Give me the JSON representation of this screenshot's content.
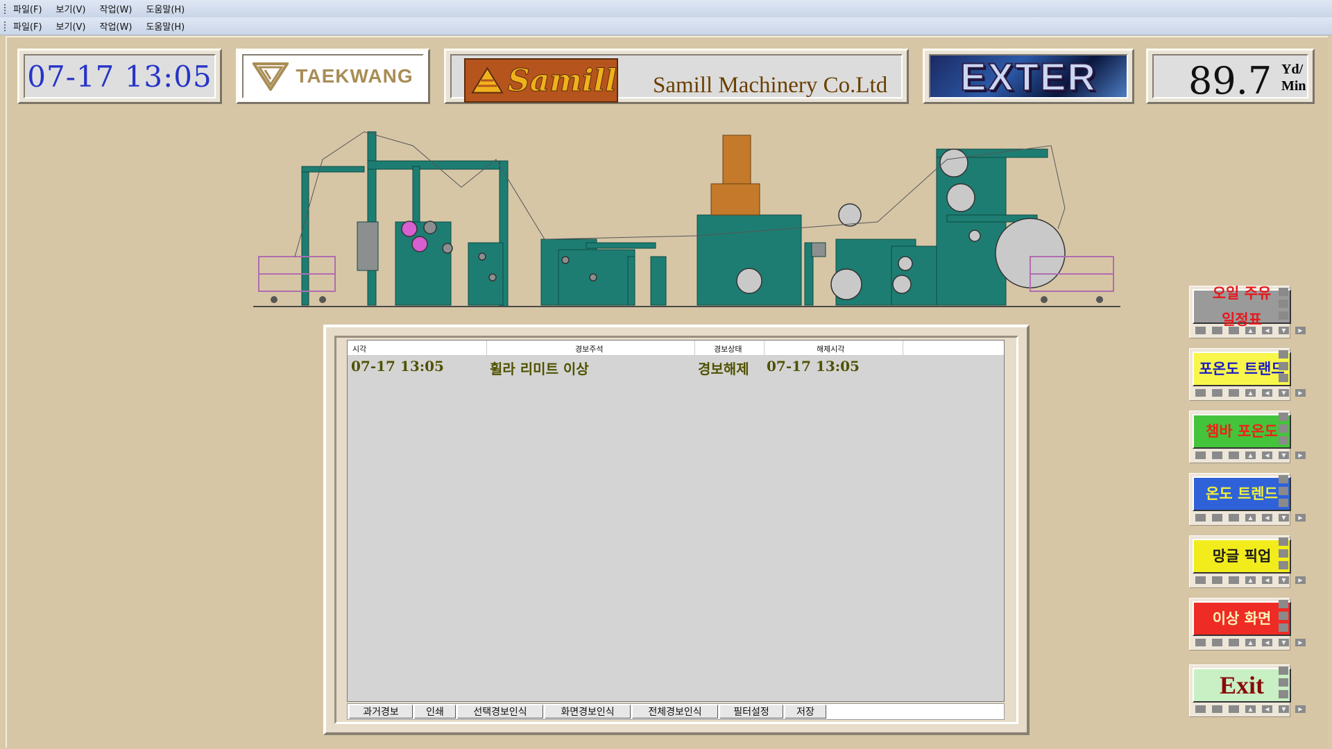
{
  "menus": {
    "top": [
      "파일(F)",
      "보기(V)",
      "작업(W)",
      "도움말(H)"
    ],
    "second": [
      "파일(F)",
      "보기(V)",
      "작업(W)",
      "도움말(H)"
    ]
  },
  "header": {
    "clock": "07-17  13:05",
    "taekwang_logo": "TAEKWANG",
    "samill_logo": "Samill",
    "samill_company": "Samill Machinery Co.Ltd",
    "exter_logo": "EXTER",
    "speed_value": "89.7",
    "speed_unit_top": "Yd/",
    "speed_unit_bottom": "Min"
  },
  "alarm": {
    "columns": [
      "시각",
      "경보주석",
      "경보상태",
      "해제시각"
    ],
    "rows": [
      {
        "time": "07-17 13:05",
        "comment": "휠라 리미트 이상",
        "status": "경보해제",
        "cleared": "07-17 13:05"
      }
    ],
    "toolbar": [
      "과거경보",
      "인쇄",
      "선택경보인식",
      "화면경보인식",
      "전체경보인식",
      "필터설정",
      "저장"
    ]
  },
  "side_buttons": [
    {
      "label_line1": "오일 주유",
      "label_line2": "일정표",
      "bg": "#9a9a9a",
      "fg": "#e8161a"
    },
    {
      "label_line1": "포온도 트랜드",
      "label_line2": "",
      "bg": "#f8f64a",
      "fg": "#1b1bc8"
    },
    {
      "label_line1": "챔바 포온도",
      "label_line2": "",
      "bg": "#44c43a",
      "fg": "#f0201a"
    },
    {
      "label_line1": "온도 트렌드",
      "label_line2": "",
      "bg": "#2f62d8",
      "fg": "#f4f03a"
    },
    {
      "label_line1": "망글 픽업",
      "label_line2": "",
      "bg": "#f2ec1c",
      "fg": "#1a1a1a"
    },
    {
      "label_line1": "이상 화면",
      "label_line2": "",
      "bg": "#ee2b24",
      "fg": "#fbf3b9"
    },
    {
      "label_line1": "Exit",
      "label_line2": "",
      "bg": "#c8f0c4",
      "fg": "#8a0a0a"
    }
  ],
  "colors": {
    "machine": "#1e7d72",
    "background": "#d6c6a6",
    "accent_roll": "#d85fd0"
  }
}
